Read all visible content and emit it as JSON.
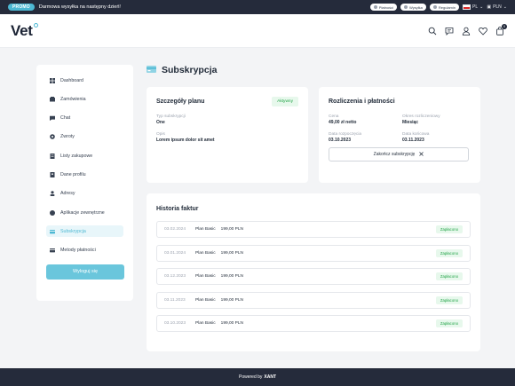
{
  "promo": {
    "badge": "PROMO",
    "text": "Darmowa wysyłka na następny dzień!"
  },
  "topbar": {
    "pills": [
      "Płatności",
      "Wysyłka",
      "Regulamin"
    ],
    "language": "PL",
    "currency": "PLN"
  },
  "header": {
    "logo": "Vet",
    "cart_count": "0",
    "icons": [
      "search-icon",
      "chat-icon",
      "user-icon",
      "heart-icon",
      "bag-icon"
    ]
  },
  "sidebar": {
    "items": [
      {
        "label": "Dashboard",
        "icon": "dashboard-icon"
      },
      {
        "label": "Zamówienia",
        "icon": "orders-icon"
      },
      {
        "label": "Chat",
        "icon": "chat-icon"
      },
      {
        "label": "Zwroty",
        "icon": "returns-icon"
      },
      {
        "label": "Listy zakupowe",
        "icon": "list-icon"
      },
      {
        "label": "Dane profilu",
        "icon": "profile-icon"
      },
      {
        "label": "Adresy",
        "icon": "address-icon"
      },
      {
        "label": "Aplikacje zewnętrzne",
        "icon": "apps-icon"
      },
      {
        "label": "Subskrypcja",
        "icon": "subscription-icon",
        "active": true
      },
      {
        "label": "Metody płatności",
        "icon": "card-icon"
      }
    ],
    "logout_label": "Wyloguj się"
  },
  "page": {
    "title": "Subskrypcja"
  },
  "plan": {
    "title": "Szczegóły planu",
    "status": "Aktywny",
    "type_label": "Typ subskrypcji",
    "type_value": "One",
    "desc_label": "Opis",
    "desc_value": "Lorem ipsum dolor sit amet"
  },
  "billing": {
    "title": "Rozliczenia i płatności",
    "price_label": "Cena",
    "price_value": "49,00 zł netto",
    "period_label": "Okres rozliczeniowy",
    "period_value": "Miesiąc",
    "start_label": "Data rozpoczęcia",
    "start_value": "03.10.2023",
    "end_label": "Data końcowa",
    "end_value": "03.11.2023",
    "cancel_label": "Zakończ subskrypcję"
  },
  "history": {
    "title": "Historia faktur",
    "rows": [
      {
        "date": "03.02.2024",
        "plan": "Plan Basic",
        "amount": "199,00 PLN",
        "status": "Zapłacono"
      },
      {
        "date": "03.01.2024",
        "plan": "Plan Basic",
        "amount": "199,00 PLN",
        "status": "Zapłacono"
      },
      {
        "date": "03.12.2023",
        "plan": "Plan Basic",
        "amount": "199,00 PLN",
        "status": "Zapłacono"
      },
      {
        "date": "03.11.2023",
        "plan": "Plan Basic",
        "amount": "199,00 PLN",
        "status": "Zapłacono"
      },
      {
        "date": "03.10.2023",
        "plan": "Plan Basic",
        "amount": "199,00 PLN",
        "status": "Zapłacono"
      }
    ]
  },
  "footer": {
    "prefix": "Powered by",
    "brand": "XANT"
  },
  "colors": {
    "accent": "#4db8d3",
    "dark": "#252b3b",
    "success": "#22a447"
  }
}
